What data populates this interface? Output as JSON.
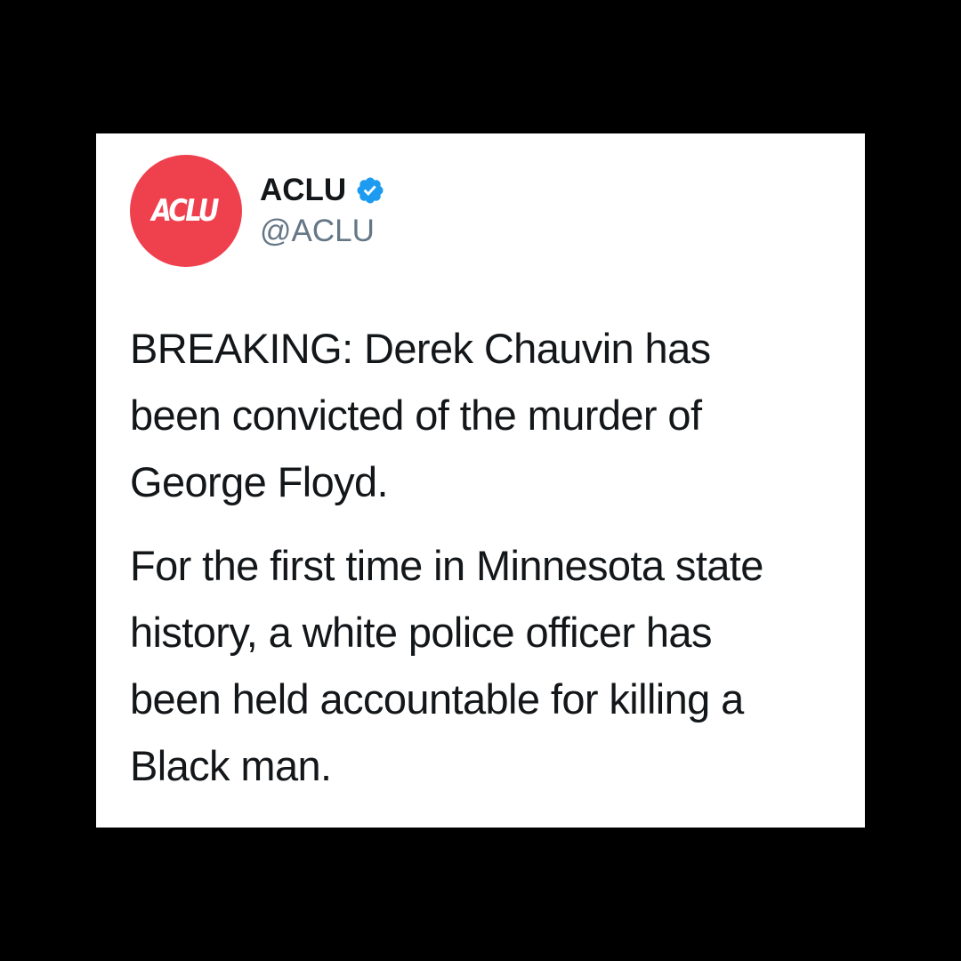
{
  "tweet": {
    "author": {
      "avatar_text": "ACLU",
      "display_name": "ACLU",
      "handle": "@ACLU",
      "verified": true,
      "verified_icon": "verified-badge-icon",
      "avatar_color": "#ef404e",
      "verified_color": "#1d9bf0"
    },
    "paragraphs": [
      "BREAKING: Derek Chauvin has\nbeen convicted of the murder of\nGeorge Floyd.",
      "For the first time in Minnesota state\nhistory, a white police officer has\nbeen held accountable for killing a\nBlack man."
    ]
  },
  "colors": {
    "background": "#000000",
    "card": "#ffffff",
    "text": "#14171a",
    "handle": "#657786"
  }
}
